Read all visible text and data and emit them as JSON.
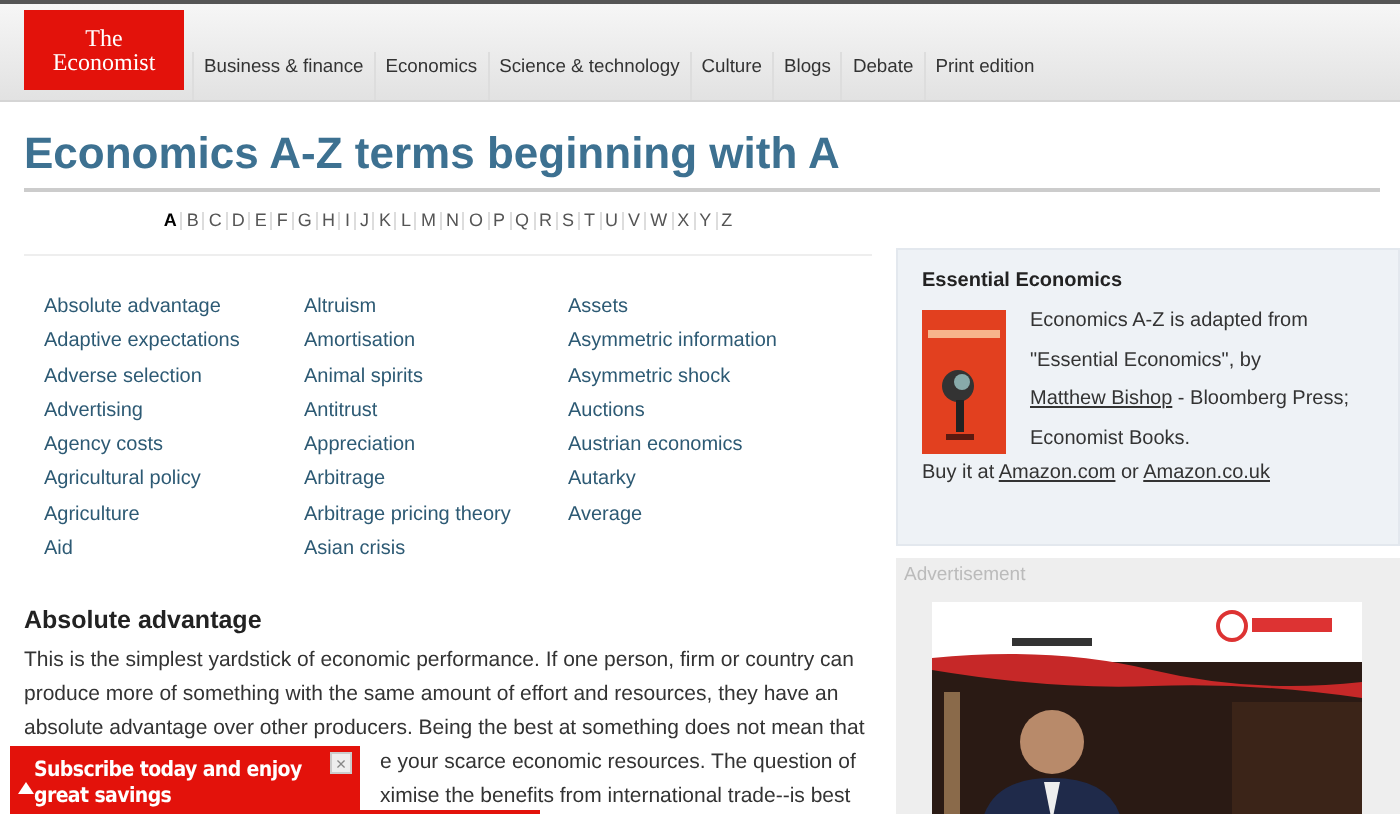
{
  "logo": {
    "line_1": "The",
    "line_2": "Economist"
  },
  "nav": [
    "Business & finance",
    "Economics",
    "Science & technology",
    "Culture",
    "Blogs",
    "Debate",
    "Print edition"
  ],
  "page_title": "Economics A-Z terms beginning with A",
  "alphabet": [
    {
      "letter": "A",
      "selected": true
    },
    {
      "letter": "B",
      "selected": false
    },
    {
      "letter": "C",
      "selected": false
    },
    {
      "letter": "D",
      "selected": false
    },
    {
      "letter": "E",
      "selected": false
    },
    {
      "letter": "F",
      "selected": false
    },
    {
      "letter": "G",
      "selected": false
    },
    {
      "letter": "H",
      "selected": false
    },
    {
      "letter": "I",
      "selected": false
    },
    {
      "letter": "J",
      "selected": false
    },
    {
      "letter": "K",
      "selected": false
    },
    {
      "letter": "L",
      "selected": false
    },
    {
      "letter": "M",
      "selected": false
    },
    {
      "letter": "N",
      "selected": false
    },
    {
      "letter": "O",
      "selected": false
    },
    {
      "letter": "P",
      "selected": false
    },
    {
      "letter": "Q",
      "selected": false
    },
    {
      "letter": "R",
      "selected": false
    },
    {
      "letter": "S",
      "selected": false
    },
    {
      "letter": "T",
      "selected": false
    },
    {
      "letter": "U",
      "selected": false
    },
    {
      "letter": "V",
      "selected": false
    },
    {
      "letter": "W",
      "selected": false
    },
    {
      "letter": "X",
      "selected": false
    },
    {
      "letter": "Y",
      "selected": false
    },
    {
      "letter": "Z",
      "selected": false
    }
  ],
  "terms": [
    [
      "Absolute advantage",
      "Adaptive expectations",
      "Adverse selection",
      "Advertising",
      "Agency costs",
      "Agricultural policy",
      "Agriculture",
      "Aid"
    ],
    [
      "Altruism",
      "Amortisation",
      "Animal spirits",
      "Antitrust",
      "Appreciation",
      "Arbitrage",
      "Arbitrage pricing theory",
      "Asian crisis"
    ],
    [
      "Assets",
      "Asymmetric information",
      "Asymmetric shock",
      "Auctions",
      "Austrian economics",
      "Autarky",
      "Average"
    ]
  ],
  "article": {
    "heading": "Absolute advantage",
    "lines": [
      "This is the simplest yardstick of economic performance. If one person, firm or country can",
      "produce more of something with the same amount of effort and resources, they have an",
      "absolute advantage over other producers. Being the best at something does not mean that"
    ],
    "partial_lines": [
      "e your scarce economic resources. The question of",
      "ximise the benefits from international trade--is best"
    ]
  },
  "sidebar": {
    "title": "Essential Economics",
    "text_1": "Economics A-Z is adapted from \"Essential Economics\", by ",
    "author_link": "Matthew Bishop",
    "text_2": " - Bloomberg Press; Economist Books.",
    "buy_text": "Buy it at ",
    "link_1": "Amazon.com",
    "or_text": " or ",
    "link_2": "Amazon.co.uk"
  },
  "advertisement": {
    "label": "Advertisement",
    "kind": "picture"
  },
  "popup": {
    "text": "Subscribe today and enjoy great savings",
    "close": "×"
  }
}
